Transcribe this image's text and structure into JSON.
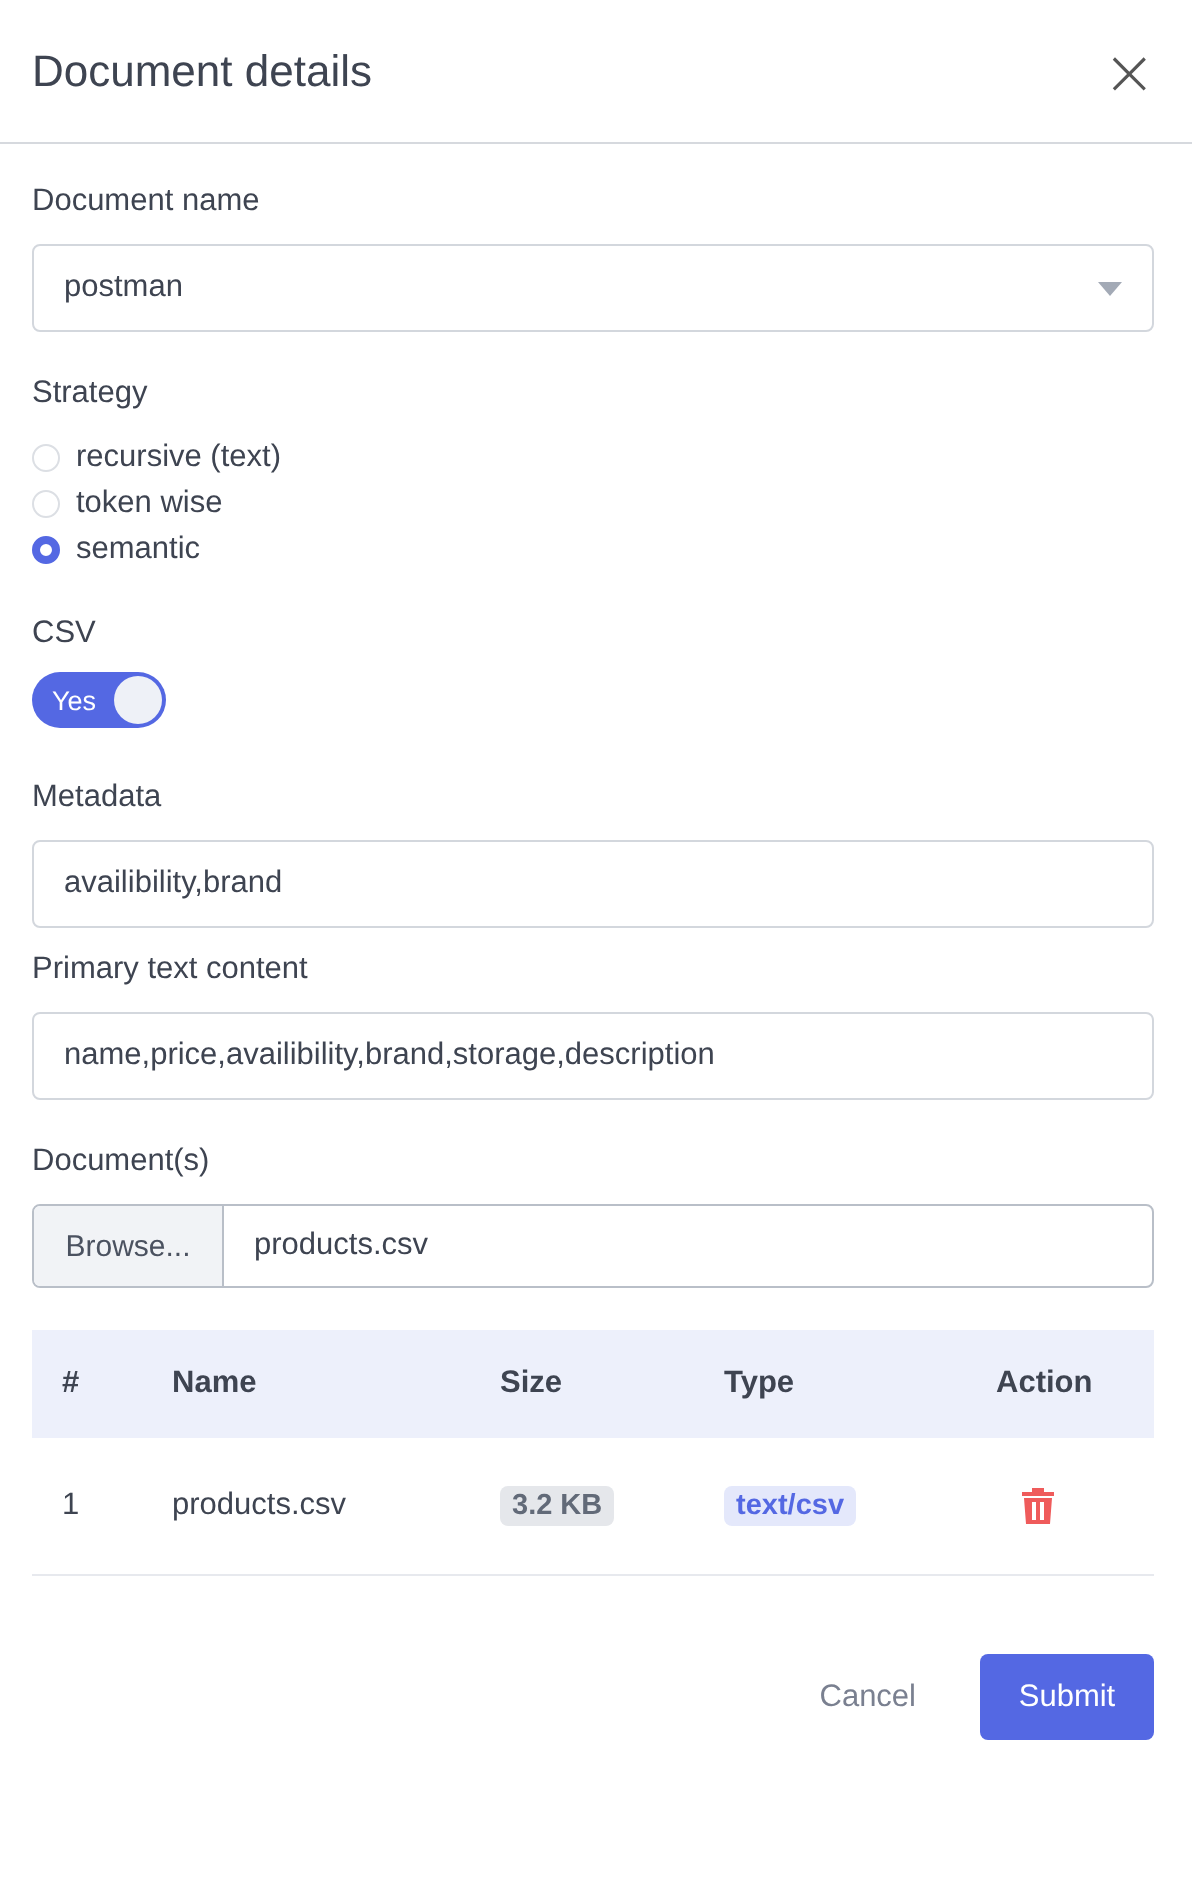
{
  "dialog": {
    "title": "Document details",
    "close_icon": "×"
  },
  "document_name": {
    "label": "Document name",
    "value": "postman"
  },
  "strategy": {
    "label": "Strategy",
    "options": [
      {
        "label": "recursive (text)",
        "selected": false
      },
      {
        "label": "token wise",
        "selected": false
      },
      {
        "label": "semantic",
        "selected": true
      }
    ]
  },
  "csv": {
    "label": "CSV",
    "on": true,
    "text": "Yes"
  },
  "metadata": {
    "label": "Metadata",
    "value": "availibility,brand"
  },
  "primary_text_content": {
    "label": "Primary text content",
    "value": "name,price,availibility,brand,storage,description"
  },
  "documents": {
    "label": "Document(s)",
    "browse": "Browse...",
    "value": "products.csv"
  },
  "table": {
    "columns": [
      "#",
      "Name",
      "Size",
      "Type",
      "Action"
    ],
    "rows": [
      {
        "index": "1",
        "name": "products.csv",
        "size": "3.2 KB",
        "type": "text/csv"
      }
    ]
  },
  "buttons": {
    "cancel": "Cancel",
    "submit": "Submit"
  }
}
